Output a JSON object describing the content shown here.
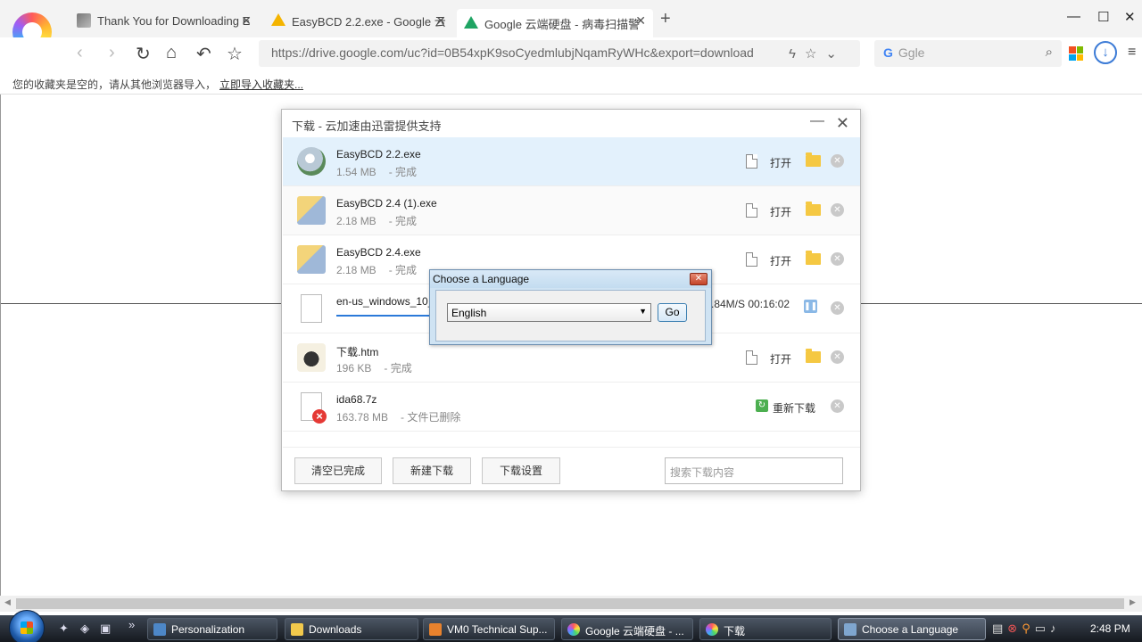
{
  "browser": {
    "tabs": [
      {
        "label": "Thank You for Downloading E",
        "icon": "app-icon"
      },
      {
        "label": "EasyBCD 2.2.exe - Google 云端",
        "icon": "google-drive-icon"
      },
      {
        "label": "Google 云端硬盘 - 病毒扫描警",
        "icon": "google-drive-icon"
      }
    ],
    "new_tab": "+",
    "url": "https://drive.google.com/uc?id=0B54xpK9soCyedmlubjNqamRyWHc&export=download",
    "search_placeholder": "Ggle",
    "search_g": "G"
  },
  "bookmark_bar": {
    "message": "您的收藏夹是空的，请从其他浏览器导入，",
    "import_link": "立即导入收藏夹..."
  },
  "download_manager": {
    "title": "下载 - 云加速由迅雷提供支持",
    "open_label": "打开",
    "items": [
      {
        "name": "EasyBCD 2.2.exe",
        "size": "1.54 MB",
        "status": "- 完成"
      },
      {
        "name": "EasyBCD 2.4 (1).exe",
        "size": "2.18 MB",
        "status": "- 完成"
      },
      {
        "name": "EasyBCD 2.4.exe",
        "size": "2.18 MB",
        "status": "- 完成"
      },
      {
        "name": "en-us_windows_10_",
        "speed": ".84M/S 00:16:02"
      },
      {
        "name": "下载.htm",
        "size": "196 KB",
        "status": "- 完成"
      },
      {
        "name": "ida68.7z",
        "size": "163.78 MB",
        "status": "- 文件已删除",
        "action": "重新下载"
      }
    ],
    "footer": {
      "clear_button": "清空已完成",
      "new_button": "新建下载",
      "settings_button": "下载设置",
      "search_placeholder": "搜索下载内容"
    }
  },
  "language_dialog": {
    "title": "Choose a Language",
    "selected": "English",
    "go_button": "Go"
  },
  "taskbar": {
    "items": [
      {
        "label": "Personalization"
      },
      {
        "label": "Downloads"
      },
      {
        "label": "VM0 Technical Sup..."
      },
      {
        "label": "Google 云端硬盘 - ..."
      },
      {
        "label": "下载"
      },
      {
        "label": "Choose a Language"
      }
    ],
    "clock": "2:48 PM"
  },
  "colors": {
    "accent": "#2b79d9",
    "selected_row": "#e3f1fc",
    "folder": "#f5c842"
  }
}
